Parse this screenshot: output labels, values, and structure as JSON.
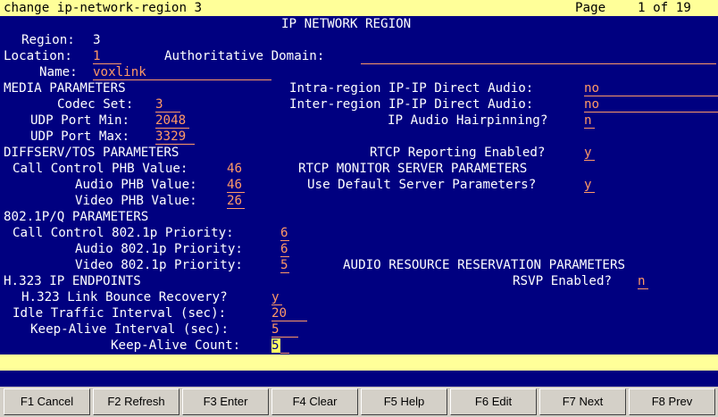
{
  "header": {
    "command": "change ip-network-region 3",
    "page_label": "Page",
    "page": "1 of 19"
  },
  "form": {
    "title": "IP NETWORK REGION",
    "region_label": "Region:",
    "region_value": "3",
    "location_label": "Location:",
    "location_value": "1",
    "auth_domain_label": "Authoritative Domain:",
    "auth_domain_value": "",
    "name_label": "Name:",
    "name_value": "voxlink",
    "media_section": "MEDIA PARAMETERS",
    "codec_label": "Codec Set:",
    "codec_value": "3",
    "udp_min_label": "UDP Port Min:",
    "udp_min_value": "2048",
    "udp_max_label": "UDP Port Max:",
    "udp_max_value": "3329",
    "intra_label": "Intra-region IP-IP Direct Audio:",
    "intra_value": "no",
    "inter_label": "Inter-region IP-IP Direct Audio:",
    "inter_value": "no",
    "hairpin_label": "IP Audio Hairpinning?",
    "hairpin_value": "n",
    "diffserv_section": "DIFFSERV/TOS PARAMETERS",
    "rtcp_label": "RTCP Reporting Enabled?",
    "rtcp_value": "y",
    "cc_phb_label": "Call Control PHB Value:",
    "cc_phb_value": "46",
    "rtcp_monitor_section": "RTCP MONITOR SERVER PARAMETERS",
    "audio_phb_label": "Audio PHB Value:",
    "audio_phb_value": "46",
    "default_server_label": "Use Default Server Parameters?",
    "default_server_value": "y",
    "video_phb_label": "Video PHB Value:",
    "video_phb_value": "26",
    "dot1p_section": "802.1P/Q PARAMETERS",
    "cc_1p_label": "Call Control 802.1p Priority:",
    "cc_1p_value": "6",
    "audio_1p_label": "Audio 802.1p Priority:",
    "audio_1p_value": "6",
    "video_1p_label": "Video 802.1p Priority:",
    "video_1p_value": "5",
    "arr_section": "AUDIO RESOURCE RESERVATION PARAMETERS",
    "h323_section": "H.323 IP ENDPOINTS",
    "rsvp_label": "RSVP Enabled?",
    "rsvp_value": "n",
    "bounce_label": "H.323 Link Bounce Recovery?",
    "bounce_value": "y",
    "idle_label": "Idle Traffic Interval (sec):",
    "idle_value": "20",
    "keepalive_label": "Keep-Alive Interval (sec):",
    "keepalive_value": "5",
    "keepalive_count_label": "Keep-Alive Count:",
    "keepalive_count_value": "5"
  },
  "fkeys": [
    "F1 Cancel",
    "F2 Refresh",
    "F3 Enter",
    "F4 Clear",
    "F5 Help",
    "F6 Edit",
    "F7 Next",
    "F8 Prev"
  ],
  "colors": {
    "background": "#000080",
    "label": "#ffffff",
    "value": "#ff9966",
    "bar": "#ffff99"
  }
}
